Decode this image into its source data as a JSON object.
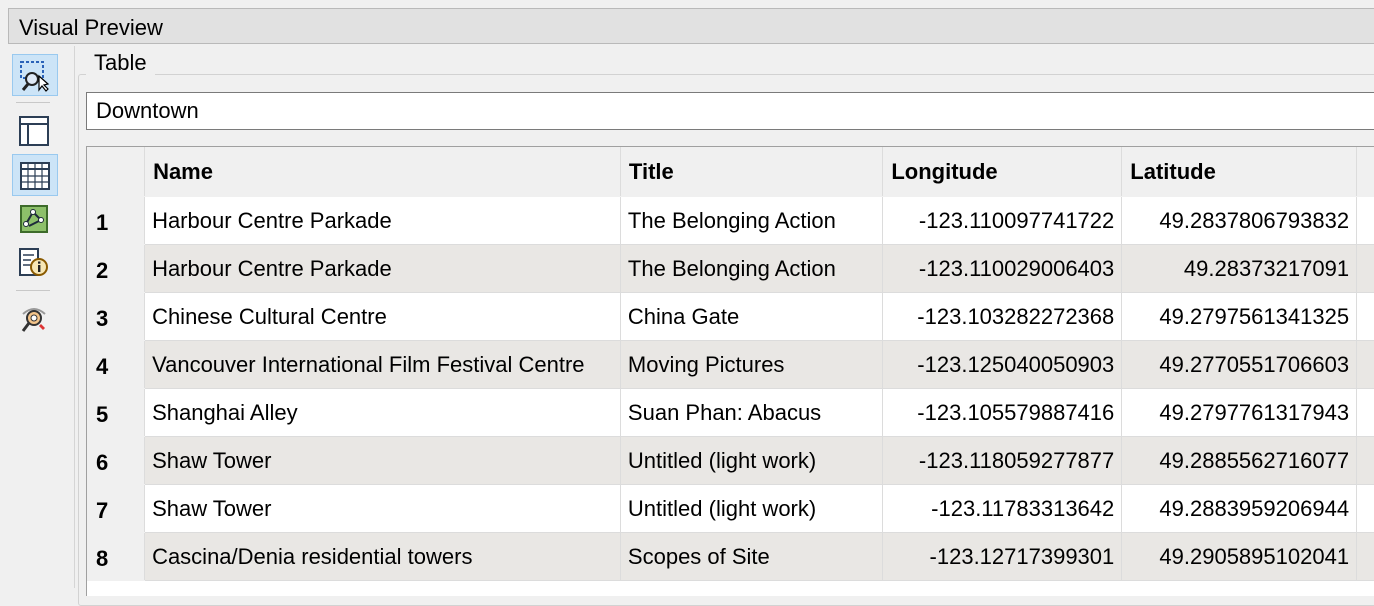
{
  "panel": {
    "title": "Visual Preview"
  },
  "toolbar": {
    "items": [
      {
        "icon": "select-zoom-icon",
        "active": true
      },
      {
        "icon": "panel-layout-icon",
        "active": false
      },
      {
        "icon": "table-view-icon",
        "active": true
      },
      {
        "icon": "graphics-view-icon",
        "active": false
      },
      {
        "icon": "feature-info-icon",
        "active": false
      },
      {
        "icon": "inspector-settings-icon",
        "active": false
      }
    ]
  },
  "group": {
    "label": "Table"
  },
  "table_selector": {
    "value": "Downtown"
  },
  "grid": {
    "columns": [
      "Name",
      "Title",
      "Longitude",
      "Latitude"
    ],
    "rows": [
      {
        "n": "1",
        "name": "Harbour Centre Parkade",
        "title": "The Belonging Action",
        "lon": "-123.110097741722",
        "lat": "49.2837806793832"
      },
      {
        "n": "2",
        "name": "Harbour Centre Parkade",
        "title": "The Belonging Action",
        "lon": "-123.110029006403",
        "lat": "49.28373217091"
      },
      {
        "n": "3",
        "name": "Chinese Cultural Centre",
        "title": "China Gate",
        "lon": "-123.103282272368",
        "lat": "49.2797561341325"
      },
      {
        "n": "4",
        "name": "Vancouver International Film Festival Centre",
        "title": "Moving Pictures",
        "lon": "-123.125040050903",
        "lat": "49.2770551706603"
      },
      {
        "n": "5",
        "name": "Shanghai Alley",
        "title": "Suan Phan: Abacus",
        "lon": "-123.105579887416",
        "lat": "49.2797761317943"
      },
      {
        "n": "6",
        "name": "Shaw Tower",
        "title": "Untitled (light work)",
        "lon": "-123.118059277877",
        "lat": "49.2885562716077"
      },
      {
        "n": "7",
        "name": "Shaw Tower",
        "title": "Untitled (light work)",
        "lon": "-123.11783313642",
        "lat": "49.2883959206944"
      },
      {
        "n": "8",
        "name": "Cascina/Denia residential towers",
        "title": "Scopes of Site",
        "lon": "-123.12717399301",
        "lat": "49.2905895102041"
      }
    ]
  }
}
